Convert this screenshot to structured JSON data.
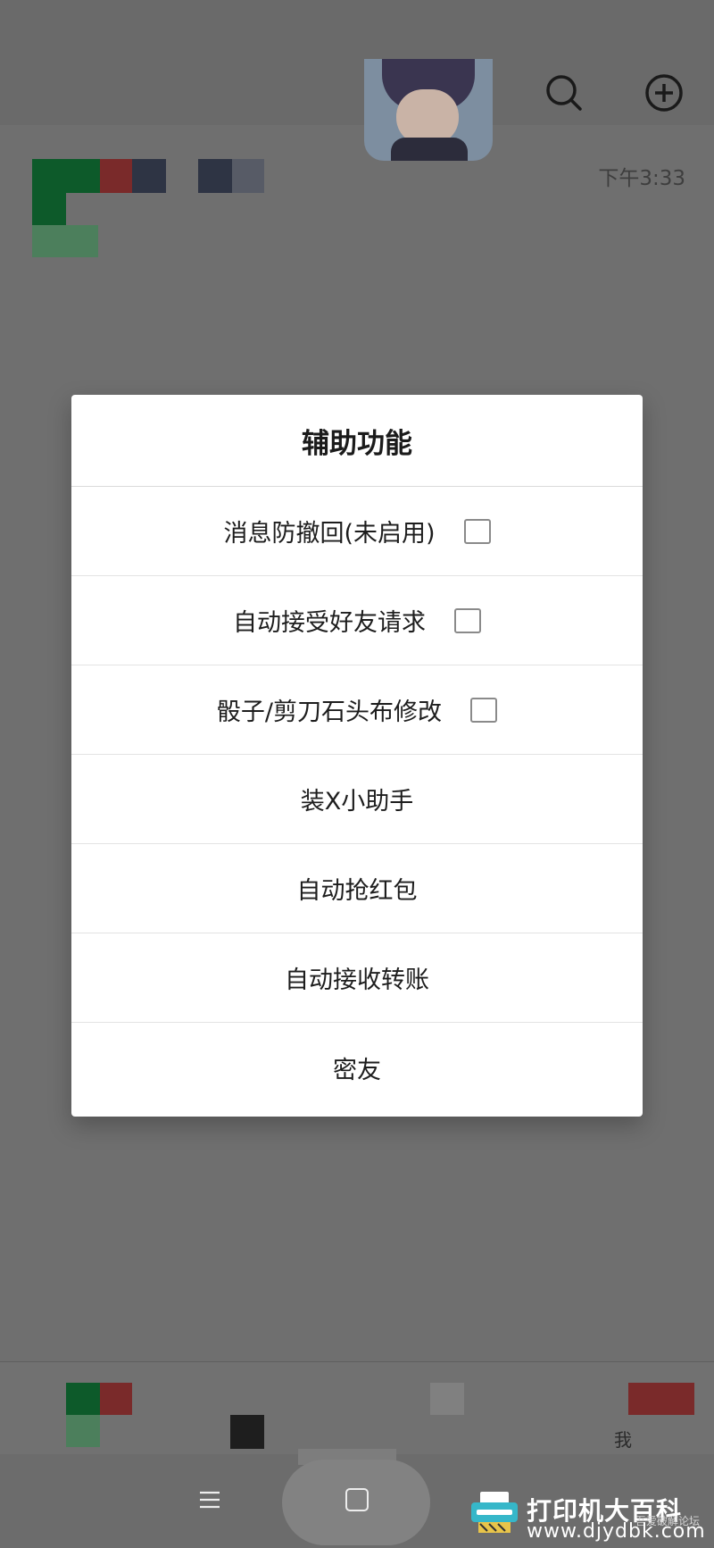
{
  "chat": {
    "time": "下午3:33"
  },
  "dialog": {
    "title": "辅助功能",
    "options": [
      {
        "label": "消息防撤回(未启用)",
        "has_checkbox": true,
        "checked": false
      },
      {
        "label": "自动接受好友请求",
        "has_checkbox": true,
        "checked": false
      },
      {
        "label": "骰子/剪刀石头布修改",
        "has_checkbox": true,
        "checked": false
      },
      {
        "label": "装X小助手",
        "has_checkbox": false
      },
      {
        "label": "自动抢红包",
        "has_checkbox": false
      },
      {
        "label": "自动接收转账",
        "has_checkbox": false
      },
      {
        "label": "密友",
        "has_checkbox": false
      }
    ]
  },
  "tabbar": {
    "me_label": "我"
  },
  "icons": {
    "search": "search-icon",
    "add": "plus-circle-icon",
    "menu": "menu-lines-icon",
    "home": "home-square-icon"
  },
  "watermark": {
    "title": "打印机大百科",
    "url": "www.djydbk.com",
    "caption": "吾爱破解论坛"
  },
  "colors": {
    "overlay": "#6f6f6f",
    "dialog_bg": "#ffffff",
    "text": "#1d1d1d"
  }
}
